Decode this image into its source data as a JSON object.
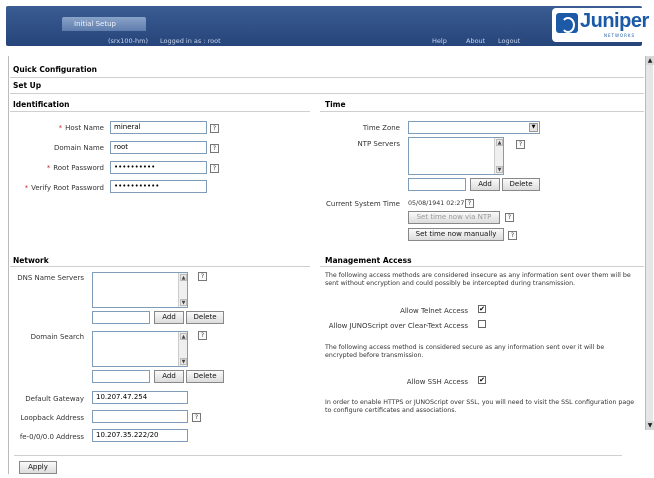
{
  "header": {
    "tab": "Initial Setup",
    "host": "(srx100-hm)",
    "logged_in": "Logged in as : root",
    "links": [
      "Help",
      "About",
      "Logout"
    ],
    "logo": "Juniper",
    "logo_sub": "NETWORKS"
  },
  "page": {
    "title": "Quick Configuration",
    "subtitle": "Set Up"
  },
  "identification": {
    "title": "Identification",
    "host_name": {
      "label": "Host Name",
      "value": "mineral"
    },
    "domain_name": {
      "label": "Domain Name",
      "value": "root"
    },
    "root_password": {
      "label": "Root Password",
      "value": "••••••••••"
    },
    "verify_password": {
      "label": "Verify Root Password",
      "value": "•••••••••••"
    }
  },
  "time": {
    "title": "Time",
    "time_zone_label": "Time Zone",
    "ntp_label": "NTP Servers",
    "add": "Add",
    "delete": "Delete",
    "current_label": "Current System Time",
    "current_value": "05/08/1941 02:27",
    "set_ntp": "Set time now via NTP",
    "set_manual": "Set time now manually"
  },
  "network": {
    "title": "Network",
    "dns_label": "DNS Name Servers",
    "domain_search_label": "Domain Search",
    "add": "Add",
    "delete": "Delete",
    "gateway": {
      "label": "Default Gateway",
      "value": "10.207.47.254"
    },
    "loopback": {
      "label": "Loopback Address",
      "value": ""
    },
    "fe": {
      "label": "fe-0/0/0.0 Address",
      "value": "10.207.35.222/20"
    }
  },
  "management": {
    "title": "Management Access",
    "insecure_text": "The following access methods are considered insecure as any information sent over them will be sent without encryption and could possibly be intercepted during transmission.",
    "telnet": {
      "label": "Allow Telnet Access",
      "checked": "✔"
    },
    "junoscript": {
      "label": "Allow JUNOScript over Clear-Text Access",
      "checked": ""
    },
    "secure_text": "The following access method is considered secure as any information sent over it will be encrypted before transmission.",
    "ssh": {
      "label": "Allow SSH Access",
      "checked": "✔"
    },
    "https_text": "In order to enable HTTPS or JUNOScript over SSL, you will need to visit the SSL configuration page to configure certificates and associations."
  },
  "apply": "Apply",
  "help_glyph": "?",
  "required_glyph": "*",
  "colors": {
    "banner": "#2d4d84",
    "brand": "#1c5aa8",
    "required": "#c0282d"
  }
}
